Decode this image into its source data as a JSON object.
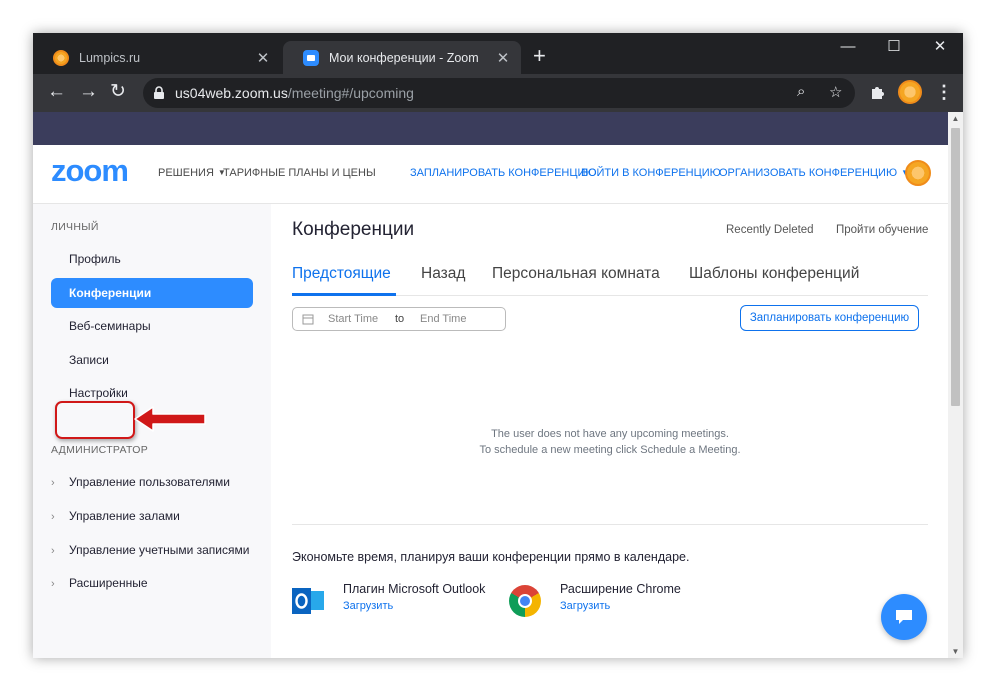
{
  "browser": {
    "tabs": [
      {
        "title": "Lumpics.ru",
        "active": false
      },
      {
        "title": "Мои конференции - Zoom",
        "active": true
      }
    ],
    "url_host": "us04web.zoom.us",
    "url_path": "/meeting#/upcoming",
    "icons": [
      "back-icon",
      "forward-icon",
      "reload-icon",
      "lock-icon",
      "zoom-icon",
      "star-icon",
      "extensions-icon",
      "profile-avatar",
      "menu-icon"
    ]
  },
  "header": {
    "logo": "zoom",
    "nav_solutions": "РЕШЕНИЯ",
    "nav_plans": "ТАРИФНЫЕ ПЛАНЫ И ЦЕНЫ",
    "nav_schedule": "ЗАПЛАНИРОВАТЬ КОНФЕРЕНЦИЮ",
    "nav_join": "ВОЙТИ В КОНФЕРЕНЦИЮ",
    "nav_host": "ОРГАНИЗОВАТЬ КОНФЕРЕНЦИЮ"
  },
  "sidebar": {
    "personal_title": "ЛИЧНЫЙ",
    "items": [
      {
        "label": "Профиль"
      },
      {
        "label": "Конференции",
        "active": true
      },
      {
        "label": "Веб-семинары"
      },
      {
        "label": "Записи"
      },
      {
        "label": "Настройки",
        "highlighted": true
      }
    ],
    "admin_title": "АДМИНИСТРАТОР",
    "admin_items": [
      {
        "label": "Управление пользователями"
      },
      {
        "label": "Управление залами"
      },
      {
        "label": "Управление учетными записями"
      },
      {
        "label": "Расширенные"
      }
    ]
  },
  "main": {
    "title": "Конференции",
    "recently_deleted": "Recently Deleted",
    "training": "Пройти обучение",
    "tabs": [
      {
        "label": "Предстоящие",
        "active": true
      },
      {
        "label": "Назад"
      },
      {
        "label": "Персональная комната"
      },
      {
        "label": "Шаблоны конференций"
      }
    ],
    "date_start_placeholder": "Start Time",
    "date_to": "to",
    "date_end_placeholder": "End Time",
    "schedule_button": "Запланировать конференцию",
    "empty_line1": "The user does not have any upcoming meetings.",
    "empty_line2": "To schedule a new meeting click Schedule a Meeting.",
    "calendar_text": "Экономьте время, планируя ваши конференции прямо в календаре.",
    "plugins": [
      {
        "name": "Плагин Microsoft Outlook",
        "link": "Загрузить",
        "icon": "outlook-icon"
      },
      {
        "name": "Расширение Chrome",
        "link": "Загрузить",
        "icon": "chrome-icon"
      }
    ]
  },
  "colors": {
    "accent": "#2d8cff",
    "link": "#0e72ed",
    "annotation": "#d01818",
    "browser_dark": "#202124",
    "banner": "#3b3d5c"
  }
}
